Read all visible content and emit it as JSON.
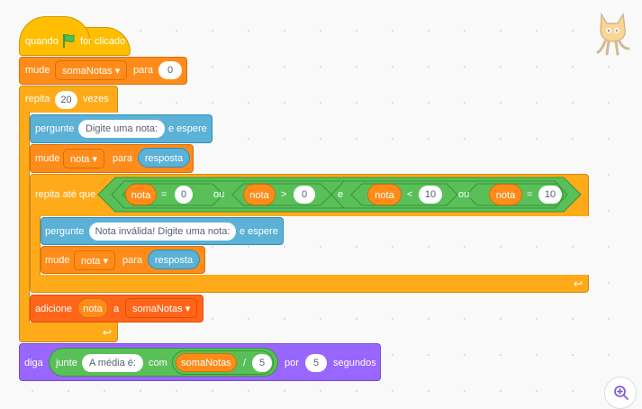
{
  "hat": {
    "label_pre": "quando",
    "label_post": "for clicado"
  },
  "set1": {
    "label": "mude",
    "var": "somaNotas",
    "to": "para",
    "value": "0"
  },
  "repeat": {
    "label": "repita",
    "count": "20",
    "times": "vezes"
  },
  "ask1": {
    "label": "pergunte",
    "text": "Digite uma nota:",
    "post": "e espere"
  },
  "set2": {
    "label": "mude",
    "var": "nota",
    "to": "para",
    "value": "resposta"
  },
  "until": {
    "label": "repita até que",
    "c1": {
      "left": "nota",
      "op": "=",
      "right": "0"
    },
    "or1": "ou",
    "c2": {
      "left": "nota",
      "op": ">",
      "right": "0"
    },
    "and": "e",
    "c3": {
      "left": "nota",
      "op": "<",
      "right": "10"
    },
    "or2": "ou",
    "c4": {
      "left": "nota",
      "op": "=",
      "right": "10"
    }
  },
  "ask2": {
    "label": "pergunte",
    "text": "Nota inválida! Digite uma nota:",
    "post": "e espere"
  },
  "set3": {
    "label": "mude",
    "var": "nota",
    "to": "para",
    "value": "resposta"
  },
  "add": {
    "label": "adicione",
    "item": "nota",
    "to": "a",
    "list": "somaNotas"
  },
  "say": {
    "label": "diga",
    "join": "junte",
    "text": "A média é:",
    "with": "com",
    "var": "somaNotas",
    "div": "/",
    "den": "5",
    "for": "por",
    "secs": "5",
    "unit": "segundos"
  },
  "colors": {
    "control": "#ffab19",
    "events": "#ffbf00",
    "variables": "#ff8c1a",
    "sensing": "#5cb1d6",
    "looks": "#9966ff",
    "operators": "#59c059"
  },
  "icons": [
    "green-flag-icon",
    "dropdown-arrow-icon",
    "loop-arrow-icon",
    "sprite-cat-icon",
    "zoom-in-icon"
  ]
}
